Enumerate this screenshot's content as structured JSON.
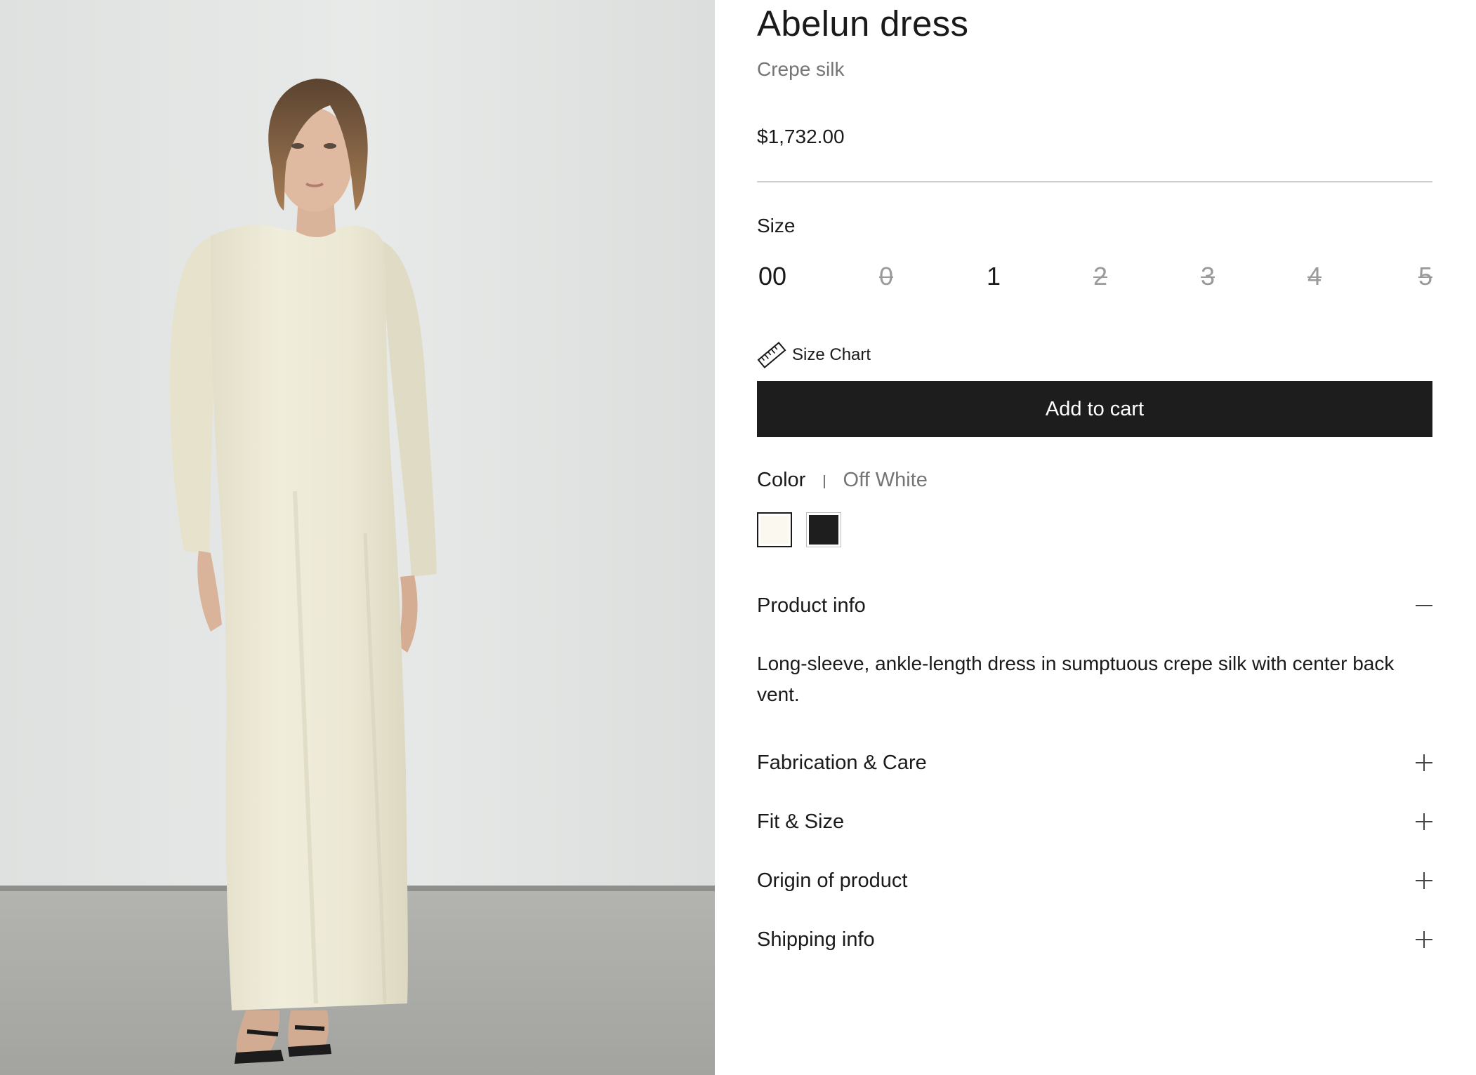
{
  "product": {
    "title": "Abelun dress",
    "subtitle": "Crepe silk",
    "price": "$1,732.00"
  },
  "size": {
    "label": "Size",
    "options": [
      {
        "label": "00",
        "available": true
      },
      {
        "label": "0",
        "available": false
      },
      {
        "label": "1",
        "available": true
      },
      {
        "label": "2",
        "available": false
      },
      {
        "label": "3",
        "available": false
      },
      {
        "label": "4",
        "available": false
      },
      {
        "label": "5",
        "available": false
      }
    ],
    "chart_link": "Size Chart"
  },
  "cart": {
    "button_label": "Add to cart"
  },
  "color": {
    "label": "Color",
    "separator": "|",
    "selected": "Off White",
    "swatches": [
      {
        "color": "#fbf8ef",
        "selected": true
      },
      {
        "color": "#1e1e1e",
        "selected": false
      }
    ]
  },
  "sections": [
    {
      "label": "Product info",
      "expanded": true,
      "icon": "minus-icon"
    },
    {
      "label": "Fabrication & Care",
      "expanded": false,
      "icon": "plus-icon"
    },
    {
      "label": "Fit & Size",
      "expanded": false,
      "icon": "plus-icon"
    },
    {
      "label": "Origin of product",
      "expanded": false,
      "icon": "plus-icon"
    },
    {
      "label": "Shipping info",
      "expanded": false,
      "icon": "plus-icon"
    }
  ],
  "product_info": {
    "description": "Long-sleeve, ankle-length dress in sumptuous crepe silk with center back vent."
  },
  "colors": {
    "button_bg": "#1d1d1d",
    "muted_text": "#757575",
    "dress": "#ece9d5",
    "wall": "#e4e6e5",
    "floor": "#a9a9a6"
  }
}
